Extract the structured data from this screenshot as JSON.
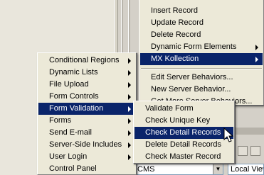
{
  "top_menu": {
    "items": [
      {
        "label": "Insert Record"
      },
      {
        "label": "Update Record"
      },
      {
        "label": "Delete Record"
      },
      {
        "label": "Dynamic Form Elements"
      },
      {
        "label": "MX Kollection"
      }
    ],
    "items2": [
      {
        "label": "Edit Server Behaviors..."
      },
      {
        "label": "New Server Behavior..."
      },
      {
        "label": "Get More Server Behaviors..."
      }
    ]
  },
  "left_menu": {
    "items": [
      {
        "label": "Conditional Regions"
      },
      {
        "label": "Dynamic Lists"
      },
      {
        "label": "File Upload"
      },
      {
        "label": "Form Controls"
      },
      {
        "label": "Form Validation"
      },
      {
        "label": "Forms"
      },
      {
        "label": "Send E-mail"
      },
      {
        "label": "Server-Side Includes"
      },
      {
        "label": "User Login"
      },
      {
        "label": "Control Panel"
      }
    ]
  },
  "sub_menu": {
    "items": [
      {
        "label": "Validate Form"
      },
      {
        "label": "Check Unique Key"
      },
      {
        "label": "Check Detail Records"
      },
      {
        "label": "Delete Detail Records"
      },
      {
        "label": "Check Master Record"
      }
    ]
  },
  "statusbar": {
    "site_select": "CMS",
    "view_select": "Local View"
  },
  "colors": {
    "menu_bg": "#ece9d8",
    "highlight": "#0a246a",
    "highlight_text": "#ffffff"
  }
}
